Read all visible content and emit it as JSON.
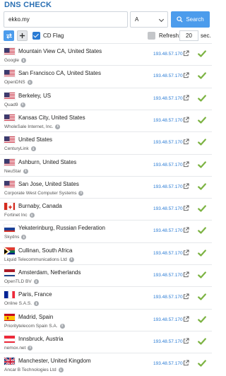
{
  "title": "DNS CHECK",
  "search": {
    "domain": "ekko.my",
    "record_type": "A",
    "button_label": "Search"
  },
  "options": {
    "cd_flag_label": "CD Flag",
    "cd_flag_checked": true,
    "refresh_label": "Refresh:",
    "refresh_value": "20",
    "refresh_unit": "sec.",
    "refresh_checked": false
  },
  "icons": {
    "refresh": "refresh-arrows-icon",
    "add": "plus-icon",
    "search": "search-icon",
    "info": "info-icon",
    "open": "external-link-icon",
    "status": "check-icon"
  },
  "colors": {
    "accent": "#4c9cec",
    "link": "#2a7bd4",
    "ok": "#7cb342",
    "title": "#2a6fb3"
  },
  "servers": [
    {
      "flag": "us",
      "location": "Mountain View CA, United States",
      "isp": "Google",
      "ip": "193.48.57.170",
      "status": "ok"
    },
    {
      "flag": "us",
      "location": "San Francisco CA, United States",
      "isp": "OpenDNS",
      "ip": "193.48.57.170",
      "status": "ok"
    },
    {
      "flag": "us",
      "location": "Berkeley, US",
      "isp": "Quad9",
      "ip": "193.48.57.170",
      "status": "ok"
    },
    {
      "flag": "us",
      "location": "Kansas City, United States",
      "isp": "WholeSale Internet, Inc.",
      "ip": "193.48.57.170",
      "status": "ok"
    },
    {
      "flag": "us",
      "location": "United States",
      "isp": "CenturyLink",
      "ip": "193.48.57.170",
      "status": "ok"
    },
    {
      "flag": "us",
      "location": "Ashburn, United States",
      "isp": "NeuStar",
      "ip": "193.48.57.170",
      "status": "ok"
    },
    {
      "flag": "us",
      "location": "San Jose, United States",
      "isp": "Corporate West Computer Systems",
      "ip": "193.48.57.170",
      "status": "ok"
    },
    {
      "flag": "ca",
      "location": "Burnaby, Canada",
      "isp": "Fortinet Inc",
      "ip": "193.48.57.170",
      "status": "ok"
    },
    {
      "flag": "ru",
      "location": "Yekaterinburg, Russian Federation",
      "isp": "Skydns",
      "ip": "193.48.57.170",
      "status": "ok"
    },
    {
      "flag": "za",
      "location": "Cullinan, South Africa",
      "isp": "Liquid Telecommunications Ltd",
      "ip": "193.48.57.170",
      "status": "ok"
    },
    {
      "flag": "nl",
      "location": "Amsterdam, Netherlands",
      "isp": "OpenTLD BV",
      "ip": "193.48.57.170",
      "status": "ok"
    },
    {
      "flag": "fr",
      "location": "Paris, France",
      "isp": "Online S.A.S.",
      "ip": "193.48.57.170",
      "status": "ok"
    },
    {
      "flag": "es",
      "location": "Madrid, Spain",
      "isp": "Prioritytelecom Spain S.A.",
      "ip": "193.48.57.170",
      "status": "ok"
    },
    {
      "flag": "at",
      "location": "Innsbruck, Austria",
      "isp": "nemox.net",
      "ip": "193.48.57.170",
      "status": "ok"
    },
    {
      "flag": "gb",
      "location": "Manchester, United Kingdom",
      "isp": "Ancar B Technologies Ltd",
      "ip": "193.48.57.170",
      "status": "ok"
    }
  ]
}
